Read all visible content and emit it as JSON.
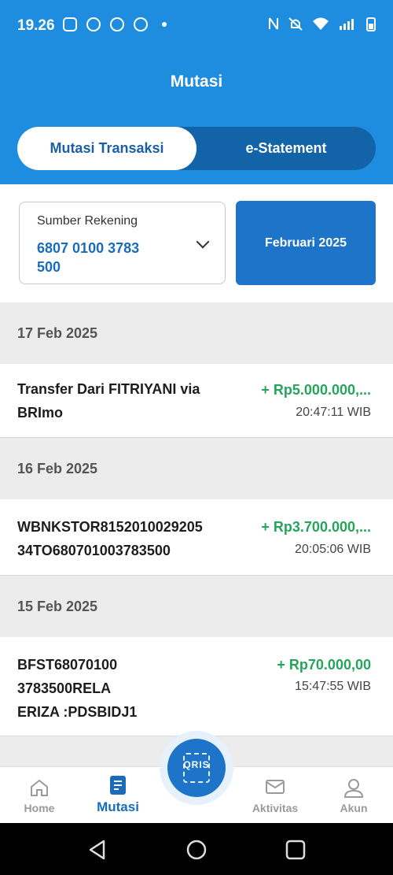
{
  "status_bar": {
    "time": "19.26"
  },
  "header": {
    "title": "Mutasi",
    "tabs": [
      {
        "label": "Mutasi Transaksi"
      },
      {
        "label": "e-Statement"
      }
    ]
  },
  "filter": {
    "account_label": "Sumber Rekening",
    "account_number": "6807 0100 3783\n500",
    "month_label": "Februari 2025"
  },
  "groups": [
    {
      "date": "17 Feb 2025",
      "tx": {
        "desc": "Transfer Dari FITRIYANI via\nBRImo",
        "amount": "+ Rp5.000.000,...",
        "time": "20:47:11 WIB"
      }
    },
    {
      "date": "16 Feb 2025",
      "tx": {
        "desc": "WBNKSTOR8152010029205\n34TO680701003783500",
        "amount": "+ Rp3.700.000,...",
        "time": "20:05:06 WIB"
      }
    },
    {
      "date": "15 Feb 2025",
      "tx": {
        "desc": "BFST68070100\n3783500RELA\nERIZA  :PDSBIDJ1",
        "amount": "+ Rp70.000,00",
        "time": "15:47:55 WIB"
      }
    }
  ],
  "nav": {
    "items": [
      {
        "label": "Home"
      },
      {
        "label": "Mutasi"
      },
      {
        "label": "Aktivitas"
      },
      {
        "label": "Akun"
      }
    ],
    "qris_label": "QRIS"
  },
  "colors": {
    "primary": "#1e8de0",
    "accent": "#1d74c9",
    "positive": "#25a45b"
  }
}
